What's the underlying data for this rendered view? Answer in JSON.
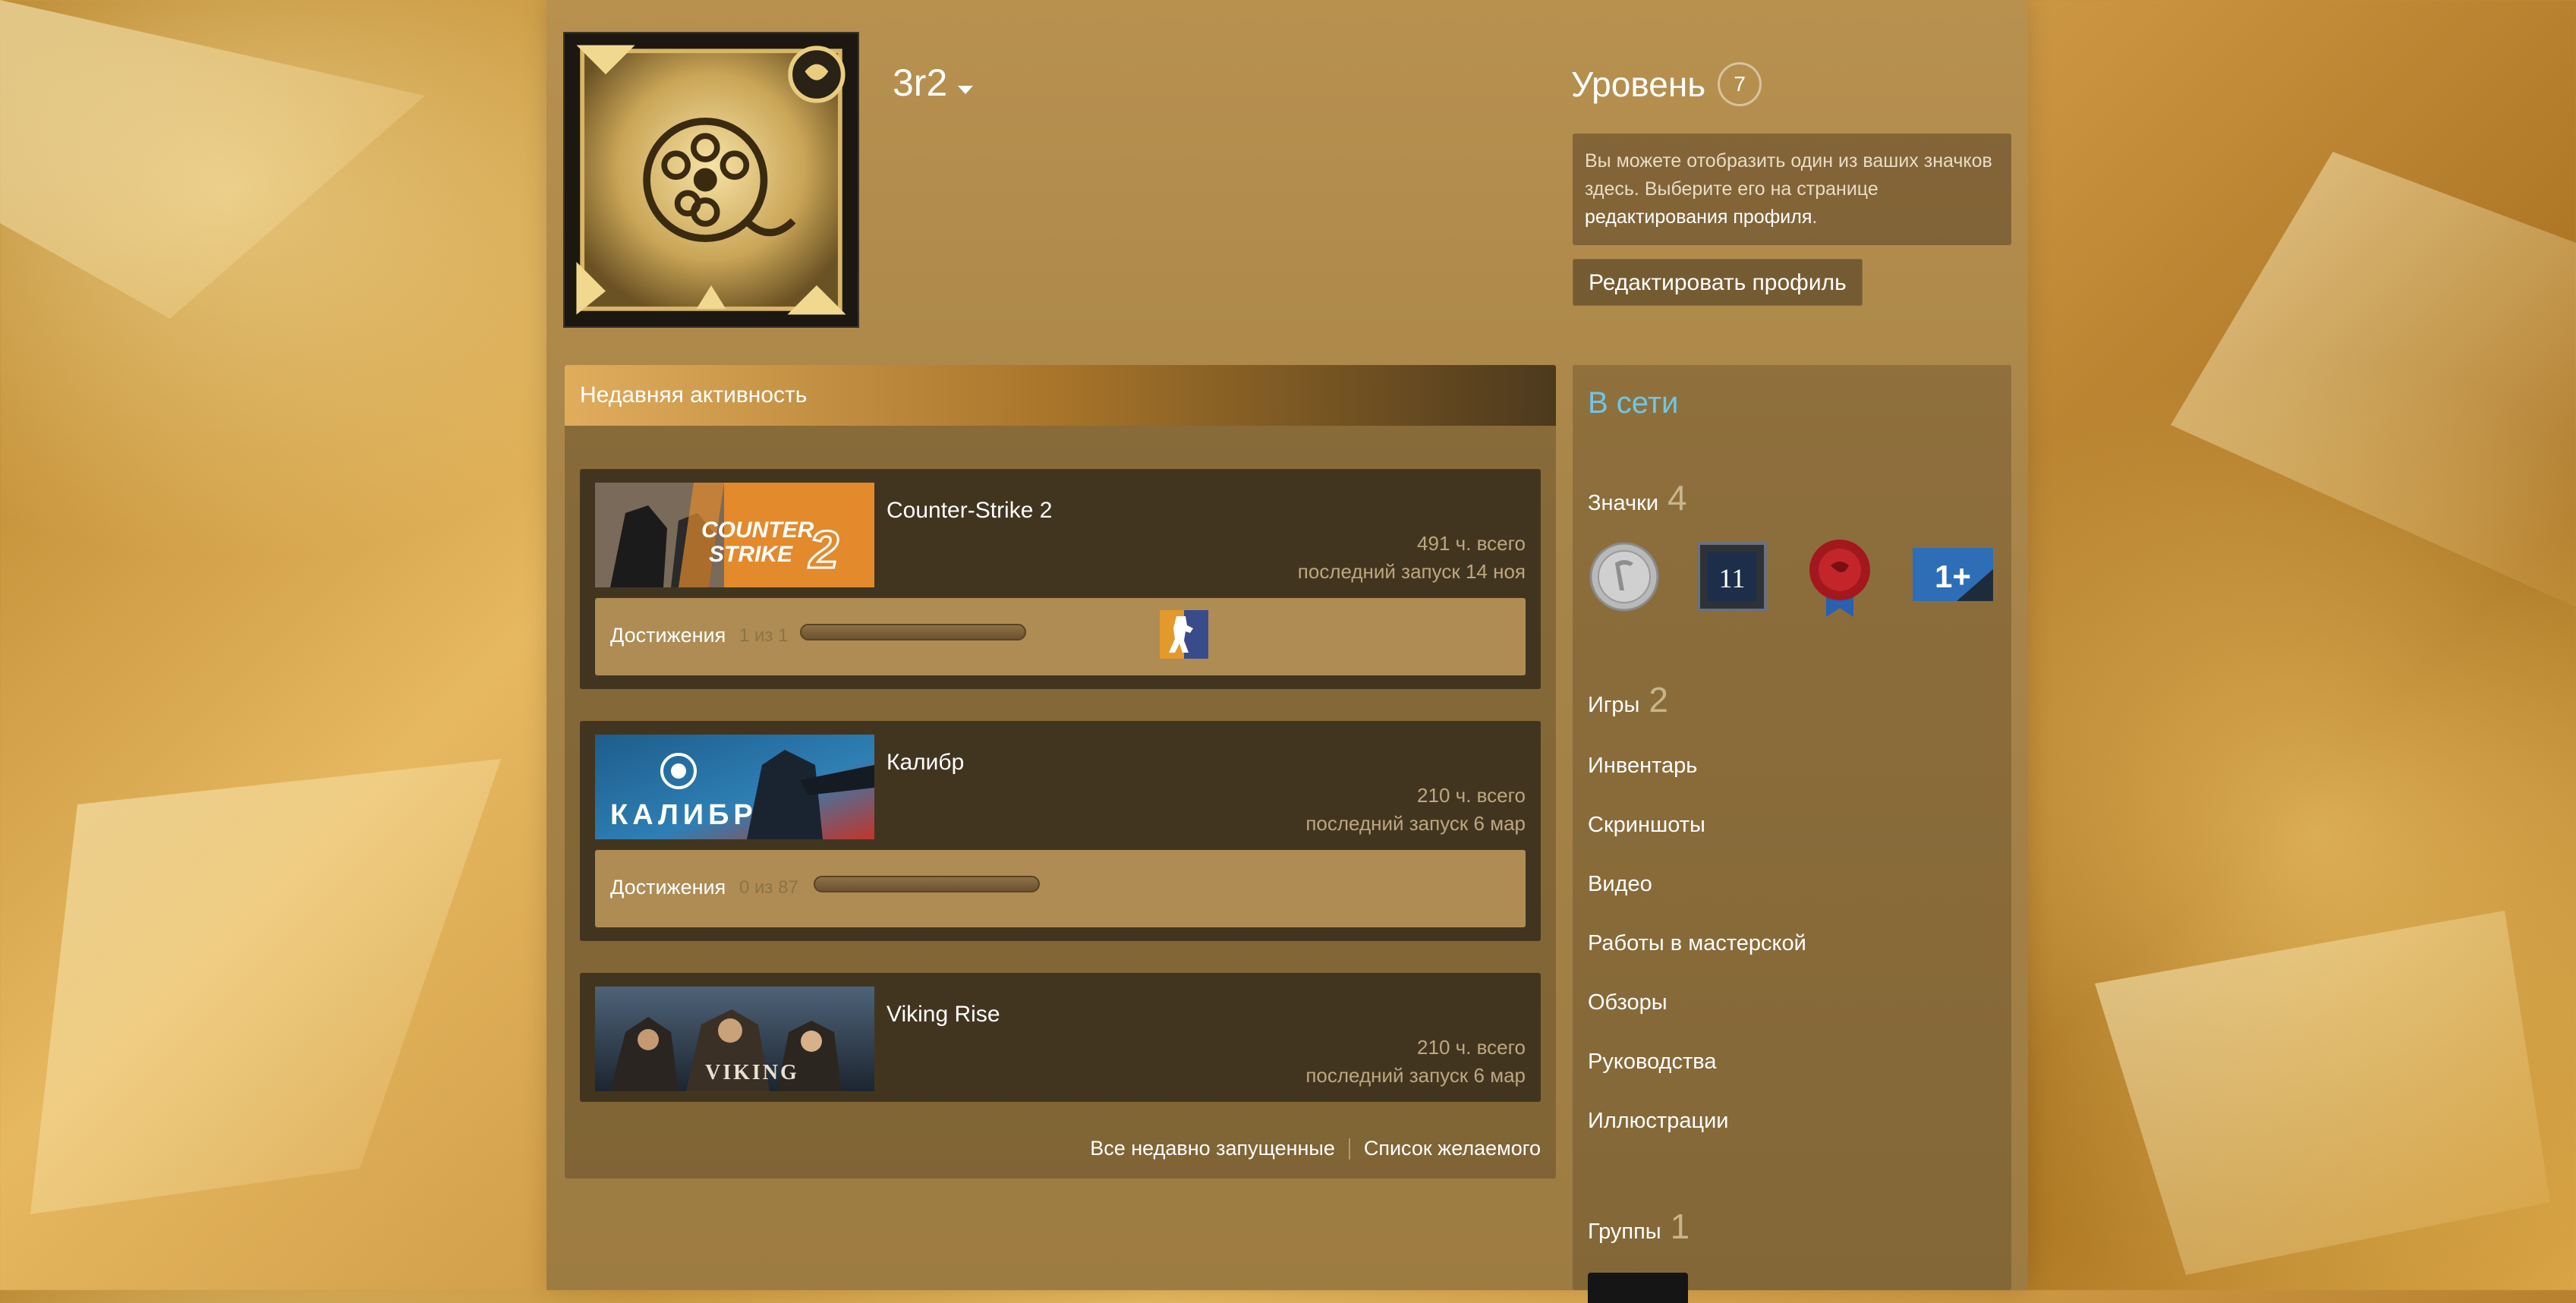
{
  "profile": {
    "persona_name": "3r2",
    "level_label": "Уровень",
    "level_value": "7",
    "badge_note_text": "Вы можете отобразить один из ваших значков здесь. Выберите его на странице ",
    "badge_note_link": "редактирования профиля",
    "badge_note_end": ".",
    "edit_button": "Редактировать профиль"
  },
  "activity": {
    "title": "Недавняя активность",
    "games": [
      {
        "name": "Counter-Strike 2",
        "hours": "491 ч. всего",
        "last_played": "последний запуск 14 ноя",
        "achievements_label": "Достижения",
        "achievements_count": "1 из 1",
        "achievement_progress": 0.0
      },
      {
        "name": "Калибр",
        "hours": "210 ч. всего",
        "last_played": "последний запуск 6 мар",
        "achievements_label": "Достижения",
        "achievements_count": "0 из 87",
        "achievement_progress": 0.0
      },
      {
        "name": "Viking Rise",
        "hours": "210 ч. всего",
        "last_played": "последний запуск 6 мар"
      }
    ],
    "footer": {
      "all_recent": "Все недавно запущенные",
      "wishlist": "Список желаемого"
    }
  },
  "sidebar": {
    "status": "В сети",
    "badges_label": "Значки",
    "badges_count": "4",
    "badge_icons": [
      "silver-coin-badge-icon",
      "years-of-service-badge-icon",
      "red-seal-badge-icon",
      "one-plus-badge-icon"
    ],
    "badge_years": "11",
    "badge_plus": "1+",
    "games_label": "Игры",
    "games_count": "2",
    "links": [
      "Инвентарь",
      "Скриншоты",
      "Видео",
      "Работы в мастерской",
      "Обзоры",
      "Руководства",
      "Иллюстрации"
    ],
    "groups_label": "Группы",
    "groups_count": "1"
  },
  "colors": {
    "status_online": "#6fc6e8",
    "accent_gold": "#c99340"
  }
}
